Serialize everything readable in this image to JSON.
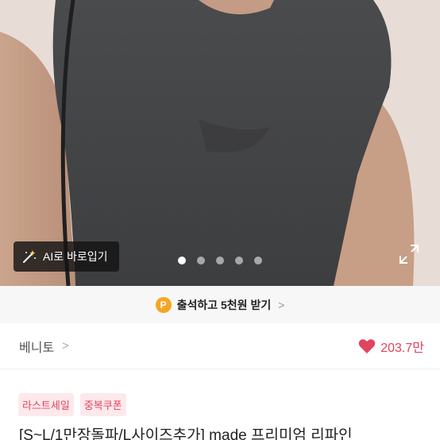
{
  "photo": {
    "ai_button_label": "AI로 바로입기",
    "dots": [
      true,
      false,
      false,
      false,
      false
    ]
  },
  "banner": {
    "coin_label": "P",
    "text": "출석하고 5천원 받기",
    "chevron": ">"
  },
  "store": {
    "name": "베니토",
    "chevron": ">",
    "likes": "203.7만"
  },
  "tags": [
    "라스트세일",
    "중복쿠폰"
  ],
  "product": {
    "title": "[S~L/1만장돌파/L사이즈추가] made 프리미엄 리파인"
  },
  "colors": {
    "accent": "#e0445e",
    "coin": "#f5a623",
    "tag_bg": "#fde9ec"
  },
  "icons": [
    "magic-wand-icon",
    "expand-icon",
    "heart-icon",
    "chevron-right-icon"
  ]
}
